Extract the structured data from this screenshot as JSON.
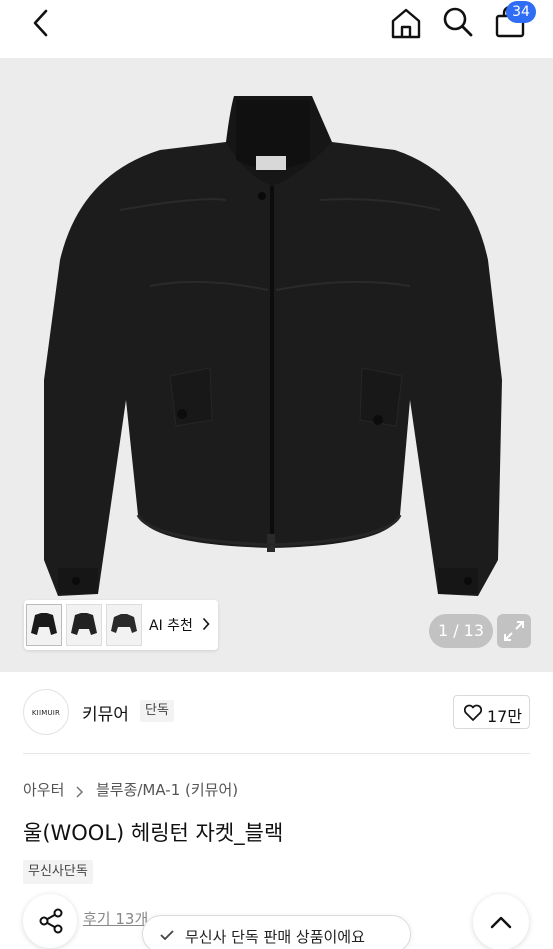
{
  "header": {
    "icons": [
      "chevron-left-icon",
      "home-icon",
      "search-icon",
      "shopping-bag-icon"
    ],
    "cart_count": "34"
  },
  "gallery": {
    "ai_recommend_label": "AI 추천",
    "counter": "1 / 13",
    "background_color": "#ececec",
    "product_color": "#1c1c1c"
  },
  "brand": {
    "logo_text": "KIIMUIR",
    "name": "키뮤어",
    "tag": "단독",
    "like_count": "17만"
  },
  "product": {
    "breadcrumb": [
      "아우터",
      "블루종/MA-1 (키뮤어)"
    ],
    "title": "울(WOOL) 헤링턴 자켓_블랙",
    "tag": "무신사단독",
    "review_link": "후기 13개"
  },
  "toast": {
    "text": "무신사 단독 판매 상품이에요"
  },
  "colors": {
    "accent": "#2f6df5",
    "text_primary": "#111111",
    "text_secondary": "#555555"
  }
}
